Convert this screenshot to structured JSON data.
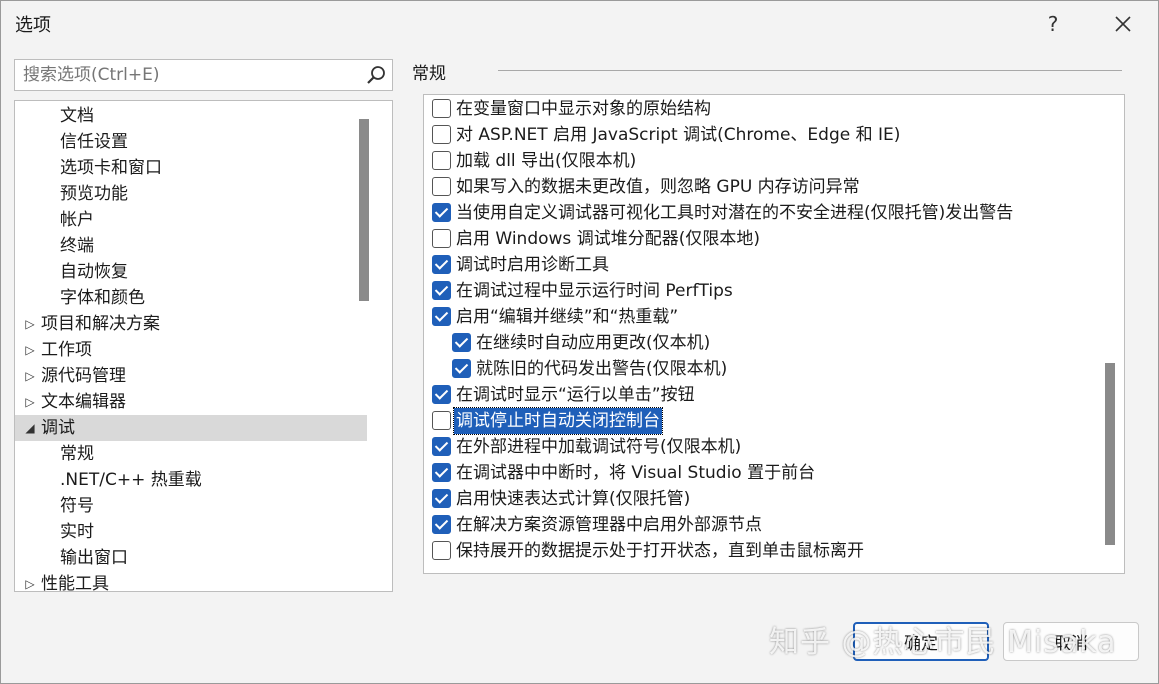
{
  "window": {
    "title": "选项",
    "help_glyph": "?",
    "close_glyph": "✕"
  },
  "search": {
    "placeholder": "搜索选项(Ctrl+E)"
  },
  "tree": {
    "items": [
      {
        "label": "文档",
        "level": 1,
        "expander": ""
      },
      {
        "label": "信任设置",
        "level": 1,
        "expander": ""
      },
      {
        "label": "选项卡和窗口",
        "level": 1,
        "expander": ""
      },
      {
        "label": "预览功能",
        "level": 1,
        "expander": ""
      },
      {
        "label": "帐户",
        "level": 1,
        "expander": ""
      },
      {
        "label": "终端",
        "level": 1,
        "expander": ""
      },
      {
        "label": "自动恢复",
        "level": 1,
        "expander": ""
      },
      {
        "label": "字体和颜色",
        "level": 1,
        "expander": ""
      },
      {
        "label": "项目和解决方案",
        "level": 0,
        "expander": "▷"
      },
      {
        "label": "工作项",
        "level": 0,
        "expander": "▷"
      },
      {
        "label": "源代码管理",
        "level": 0,
        "expander": "▷"
      },
      {
        "label": "文本编辑器",
        "level": 0,
        "expander": "▷"
      },
      {
        "label": "调试",
        "level": 0,
        "expander": "◢",
        "selected": true
      },
      {
        "label": "常规",
        "level": 1,
        "expander": ""
      },
      {
        "label": ".NET/C++ 热重载",
        "level": 1,
        "expander": ""
      },
      {
        "label": "符号",
        "level": 1,
        "expander": ""
      },
      {
        "label": "实时",
        "level": 1,
        "expander": ""
      },
      {
        "label": "输出窗口",
        "level": 1,
        "expander": ""
      },
      {
        "label": "性能工具",
        "level": 0,
        "expander": "▷"
      }
    ]
  },
  "section": {
    "title": "常规"
  },
  "options": [
    {
      "label": "在变量窗口中显示对象的原始结构",
      "checked": false,
      "indent": 0
    },
    {
      "label": "对 ASP.NET 启用 JavaScript 调试(Chrome、Edge 和 IE)",
      "checked": false,
      "indent": 0
    },
    {
      "label": "加载 dll 导出(仅限本机)",
      "checked": false,
      "indent": 0
    },
    {
      "label": "如果写入的数据未更改值，则忽略 GPU 内存访问异常",
      "checked": false,
      "indent": 0
    },
    {
      "label": "当使用自定义调试器可视化工具时对潜在的不安全进程(仅限托管)发出警告",
      "checked": true,
      "indent": 0
    },
    {
      "label": "启用 Windows 调试堆分配器(仅限本地)",
      "checked": false,
      "indent": 0
    },
    {
      "label": "调试时启用诊断工具",
      "checked": true,
      "indent": 0
    },
    {
      "label": "在调试过程中显示运行时间 PerfTips",
      "checked": true,
      "indent": 0
    },
    {
      "label": "启用“编辑并继续”和“热重载”",
      "checked": true,
      "indent": 0
    },
    {
      "label": "在继续时自动应用更改(仅本机)",
      "checked": true,
      "indent": 1
    },
    {
      "label": "就陈旧的代码发出警告(仅限本机)",
      "checked": true,
      "indent": 1
    },
    {
      "label": "在调试时显示“运行以单击”按钮",
      "checked": true,
      "indent": 0
    },
    {
      "label": "调试停止时自动关闭控制台",
      "checked": false,
      "indent": 0,
      "focused": true
    },
    {
      "label": "在外部进程中加载调试符号(仅限本机)",
      "checked": true,
      "indent": 0
    },
    {
      "label": "在调试器中中断时，将 Visual Studio 置于前台",
      "checked": true,
      "indent": 0
    },
    {
      "label": "启用快速表达式计算(仅限托管)",
      "checked": true,
      "indent": 0
    },
    {
      "label": "在解决方案资源管理器中启用外部源节点",
      "checked": true,
      "indent": 0
    },
    {
      "label": "保持展开的数据提示处于打开状态，直到单击鼠标离开",
      "checked": false,
      "indent": 0
    }
  ],
  "buttons": {
    "ok": "确定",
    "cancel": "取消"
  },
  "watermark": "知乎 @热心市民 Misaka",
  "colors": {
    "accent": "#1f5fb9",
    "selection": "#d9d9d9"
  }
}
